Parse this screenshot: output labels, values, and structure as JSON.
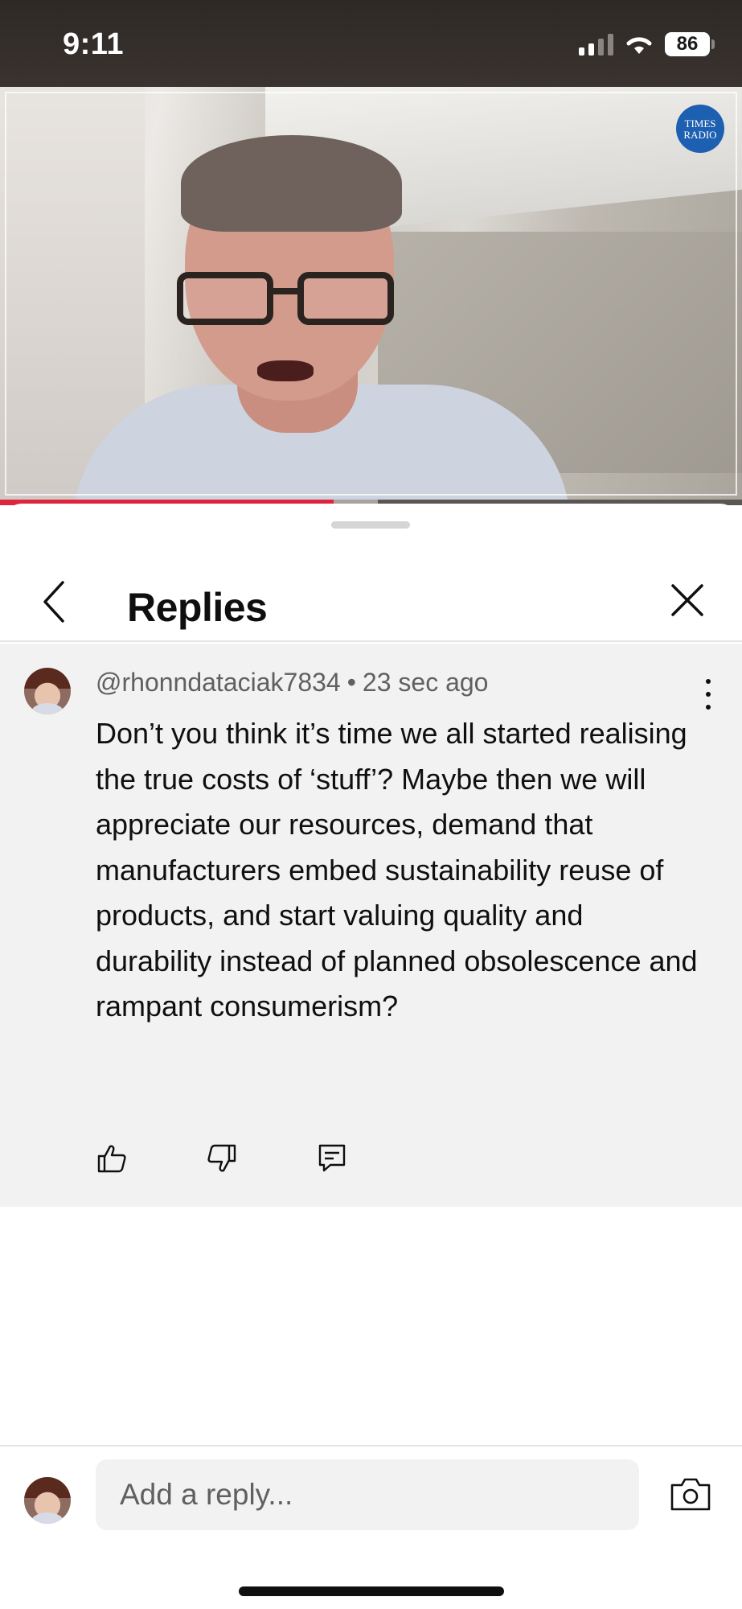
{
  "status_bar": {
    "time": "9:11",
    "battery": "86",
    "signal_bars": 4,
    "signal_bars_filled": 2,
    "wifi": true
  },
  "video": {
    "channel_logo": "TIMES RADIO",
    "progress_fraction": 0.45,
    "buffered_fraction": 0.51,
    "colors": {
      "progress": "#e0243d",
      "logo": "#1d5fb0"
    }
  },
  "replies_panel": {
    "title": "Replies",
    "back_icon": "chevron-left-icon",
    "close_icon": "close-icon",
    "comment": {
      "author": "@rhonndataciak7834",
      "separator": "•",
      "time": "23 sec ago",
      "text": "Don’t you think it’s time we all started realising the true costs of ‘stuff’? Maybe then we will appreciate our resources, demand that manufacturers embed sustainability reuse of products, and start valuing quality and durability instead of planned obsolescence and rampant consumerism?",
      "actions": [
        "thumbs-up-icon",
        "thumbs-down-icon",
        "reply-comment-icon"
      ]
    },
    "reply_input": {
      "placeholder": "Add a reply..."
    }
  }
}
